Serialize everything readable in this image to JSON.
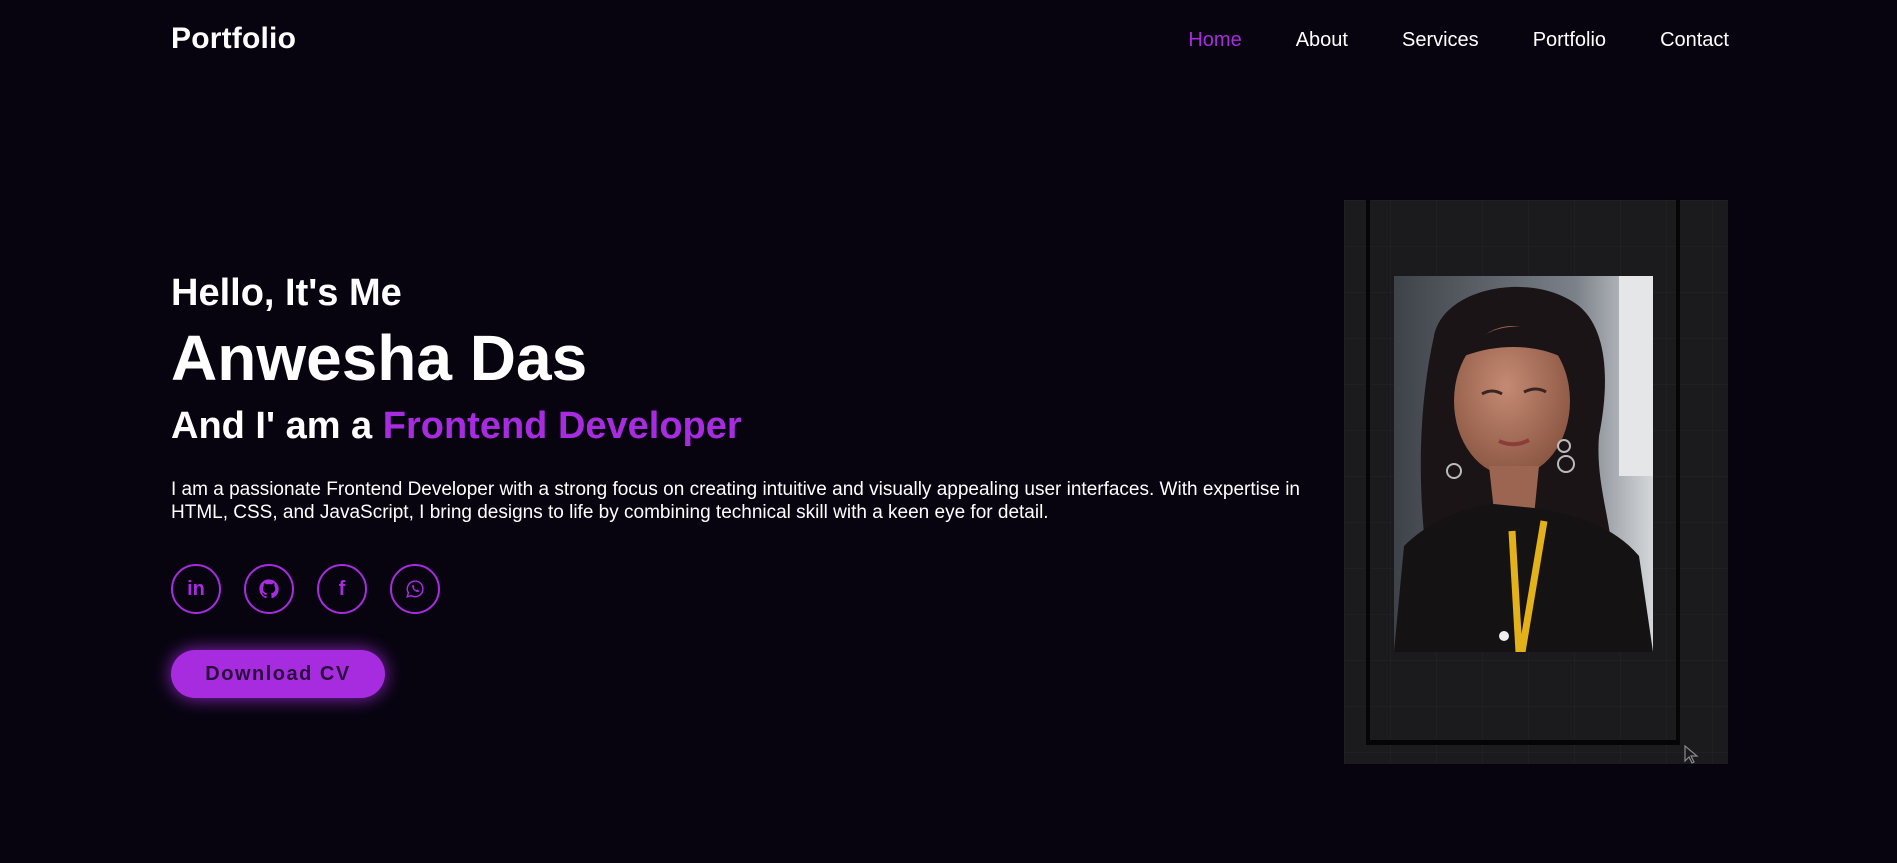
{
  "header": {
    "logo": "Portfolio",
    "nav": [
      {
        "label": "Home",
        "active": true
      },
      {
        "label": "About",
        "active": false
      },
      {
        "label": "Services",
        "active": false
      },
      {
        "label": "Portfolio",
        "active": false
      },
      {
        "label": "Contact",
        "active": false
      }
    ]
  },
  "hero": {
    "greeting": "Hello, It's Me",
    "name": "Anwesha Das",
    "role_prefix": "And I' am a ",
    "role_highlight": "Frontend Developer",
    "description": "I am a passionate Frontend Developer with a strong focus on creating intuitive and visually appealing user interfaces. With expertise in HTML, CSS, and JavaScript, I bring designs to life by combining technical skill with a keen eye for detail.",
    "socials": [
      {
        "icon": "linkedin-icon",
        "text": "in"
      },
      {
        "icon": "github-icon"
      },
      {
        "icon": "facebook-icon",
        "text": "f"
      },
      {
        "icon": "whatsapp-icon"
      }
    ],
    "cv_button": "Download CV"
  },
  "theme": {
    "background": "#07040f",
    "accent": "#a72ce0",
    "text": "#ffffff"
  }
}
